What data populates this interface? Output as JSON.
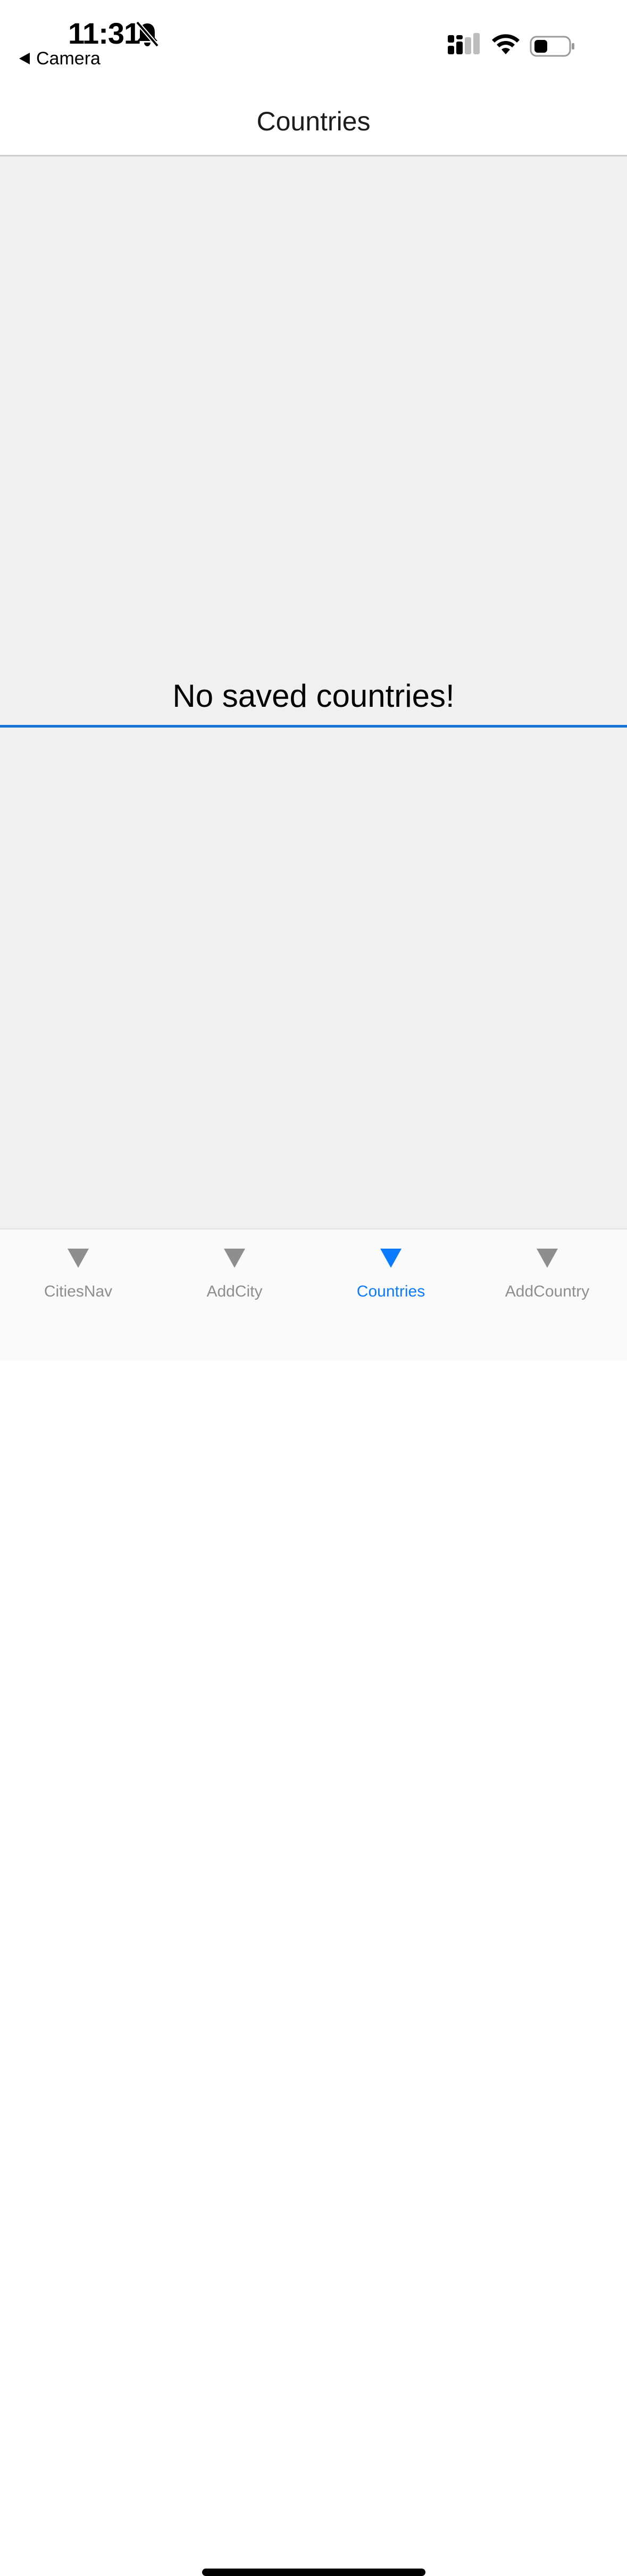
{
  "status_bar": {
    "time": "11:31",
    "back_app_label": "Camera",
    "icons": [
      "bell-slash-icon",
      "cellular-signal-icon",
      "wifi-icon",
      "battery-icon"
    ]
  },
  "header": {
    "title": "Countries"
  },
  "main": {
    "empty_message": "No saved countries!"
  },
  "tabs": [
    {
      "label": "CitiesNav",
      "active": false
    },
    {
      "label": "AddCity",
      "active": false
    },
    {
      "label": "Countries",
      "active": true
    },
    {
      "label": "AddCountry",
      "active": false
    }
  ],
  "colors": {
    "accent": "#0a7aff",
    "divider_accent": "#1a73d6",
    "content_background": "#f0f0f0",
    "inactive_tab": "#8e8e8e"
  }
}
